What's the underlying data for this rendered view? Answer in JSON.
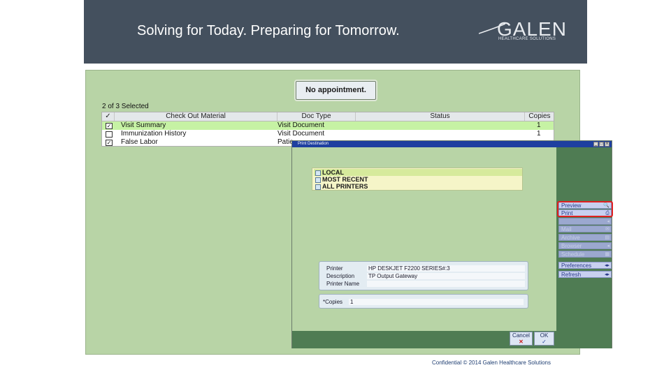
{
  "header": {
    "tagline": "Solving for Today. Preparing for Tomorrow.",
    "logo_word": "GALEN",
    "logo_sub": "HEALTHCARE SOLUTIONS"
  },
  "appointment": {
    "label": "No appointment."
  },
  "selection": {
    "count_text": "2 of 3 Selected"
  },
  "table": {
    "checkmark_header": "✓",
    "columns": [
      "Check Out Material",
      "Doc Type",
      "Status",
      "Copies"
    ],
    "rows": [
      {
        "checked": true,
        "checkmark": "✓",
        "material": "Visit Summary",
        "doc_type": "Visit Document",
        "status": "",
        "copies": "1"
      },
      {
        "checked": false,
        "checkmark": "",
        "material": "Immunization History",
        "doc_type": "Visit Document",
        "status": "",
        "copies": "1"
      },
      {
        "checked": true,
        "checkmark": "✓",
        "material": "False Labor",
        "doc_type": "Patie",
        "status": "",
        "copies": ""
      }
    ]
  },
  "dialog": {
    "title": "Print Destination",
    "window_buttons": [
      "_",
      "□",
      "x"
    ],
    "destinations": [
      {
        "label": "LOCAL",
        "selected": true
      },
      {
        "label": "MOST RECENT",
        "selected": false
      },
      {
        "label": "ALL PRINTERS",
        "selected": false
      }
    ],
    "side_buttons": [
      {
        "label": "Preview",
        "icon": "🔍",
        "icon_name": "magnifier-icon",
        "enabled": true
      },
      {
        "label": "Print",
        "icon": "⎙",
        "icon_name": "printer-icon",
        "enabled": true
      },
      {
        "label": "",
        "icon": "◂",
        "icon_name": "arrow-icon",
        "enabled": false
      },
      {
        "label": "Mail",
        "icon": "✉",
        "icon_name": "mail-icon",
        "enabled": false
      },
      {
        "label": "Archive",
        "icon": "▤",
        "icon_name": "archive-icon",
        "enabled": false
      },
      {
        "label": "Browser",
        "icon": "◂",
        "icon_name": "browser-icon",
        "enabled": false
      },
      {
        "label": "Schedule",
        "icon": "▦",
        "icon_name": "schedule-icon",
        "enabled": false
      },
      {
        "label": "Preferences",
        "icon": "◂▸",
        "icon_name": "preferences-icon",
        "enabled": true
      },
      {
        "label": "Refresh",
        "icon": "◂▸",
        "icon_name": "refresh-icon",
        "enabled": true
      }
    ],
    "printer": {
      "printer_label": "Printer",
      "printer_value": "HP DESKJET F2200 SERIES#:3",
      "description_label": "Description",
      "description_value": "TP Output Gateway",
      "name_label": "Printer Name",
      "name_value": ""
    },
    "copies": {
      "label": "*Copies",
      "value": "1"
    },
    "cancel": {
      "label": "Cancel",
      "icon": "✕"
    },
    "ok": {
      "label": "OK",
      "icon": "✓"
    }
  },
  "colors": {
    "highlight": "#e02020",
    "banner": "#44505e",
    "app_green": "#b8d4a6"
  },
  "footer": {
    "text": "Confidential © 2014 Galen Healthcare Solutions"
  }
}
